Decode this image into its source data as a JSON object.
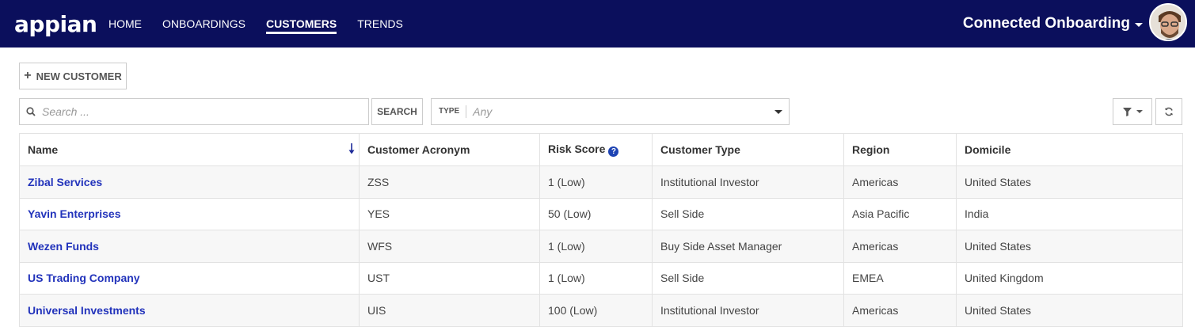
{
  "header": {
    "logo": "appian",
    "nav": [
      {
        "label": "HOME",
        "active": false
      },
      {
        "label": "ONBOARDINGS",
        "active": false
      },
      {
        "label": "CUSTOMERS",
        "active": true
      },
      {
        "label": "TRENDS",
        "active": false
      }
    ],
    "app_name": "Connected Onboarding",
    "colors": {
      "bar": "#0b0f5c",
      "link": "#2233bb",
      "help": "#1d43b3"
    }
  },
  "toolbar": {
    "new_customer_label": "NEW CUSTOMER",
    "search_placeholder": "Search ...",
    "search_button": "SEARCH",
    "type_label": "TYPE",
    "type_value": "Any"
  },
  "grid": {
    "columns": [
      "Name",
      "Customer Acronym",
      "Risk Score",
      "Customer Type",
      "Region",
      "Domicile"
    ],
    "sort": {
      "column": "Name",
      "direction": "descending"
    },
    "rows": [
      {
        "name": "Zibal Services",
        "acronym": "ZSS",
        "risk": "1 (Low)",
        "type": "Institutional Investor",
        "region": "Americas",
        "domicile": "United States"
      },
      {
        "name": "Yavin Enterprises",
        "acronym": "YES",
        "risk": "50 (Low)",
        "type": "Sell Side",
        "region": "Asia Pacific",
        "domicile": "India"
      },
      {
        "name": "Wezen Funds",
        "acronym": "WFS",
        "risk": "1 (Low)",
        "type": "Buy Side Asset Manager",
        "region": "Americas",
        "domicile": "United States"
      },
      {
        "name": "US Trading Company",
        "acronym": "UST",
        "risk": "1 (Low)",
        "type": "Sell Side",
        "region": "EMEA",
        "domicile": "United Kingdom"
      },
      {
        "name": "Universal Investments",
        "acronym": "UIS",
        "risk": "100 (Low)",
        "type": "Institutional Investor",
        "region": "Americas",
        "domicile": "United States"
      }
    ]
  }
}
